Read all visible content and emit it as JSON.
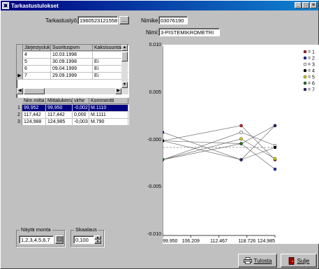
{
  "window": {
    "title": "Tarkastustulokset"
  },
  "form": {
    "tarkastustyo_label": "Tarkastustyö:",
    "tarkastustyo_value": "1960523121558",
    "browse_label": "...",
    "nimike_label": "Nimike:",
    "nimike_value": "03076190",
    "nimi_label": "Nimi:",
    "nimi_value": "3-PISTEMIKROMETRI"
  },
  "top_table": {
    "columns": [
      "Järjestysluku",
      "Suorituspvm",
      "Kaksisuuntai"
    ],
    "rows": [
      {
        "indicator": "",
        "cells": [
          "4",
          "10.03.1998",
          ""
        ]
      },
      {
        "indicator": "",
        "cells": [
          "5",
          "30.09.1998",
          "Ei"
        ]
      },
      {
        "indicator": "",
        "cells": [
          "6",
          "09.04.1999",
          "Ei"
        ]
      },
      {
        "indicator": "▶",
        "cells": [
          "7",
          "29.09.1999",
          "Ei"
        ]
      }
    ]
  },
  "meas_table": {
    "columns": [
      "Nim.mitta",
      "Mittalukema",
      "virhe",
      "Kommentti"
    ],
    "rows": [
      {
        "num": "1",
        "cells": [
          "99,952",
          "99,950",
          "-0,002",
          "M.1110"
        ],
        "selected": true
      },
      {
        "num": "2",
        "cells": [
          "117,442",
          "117,442",
          "0,000",
          "M.1111"
        ],
        "selected": false
      },
      {
        "num": "3",
        "cells": [
          "124,988",
          "124,985",
          "-0,003",
          "M.790"
        ],
        "selected": false
      }
    ]
  },
  "show_group": {
    "title": "Näytä monta",
    "value": "1,2,3,4,5,6,7"
  },
  "scale_group": {
    "title": "Skaalaus",
    "value": "0,100"
  },
  "buttons": {
    "print": "Tulosta",
    "close": "Sulje"
  },
  "chart_data": {
    "type": "line",
    "y_ticks": [
      "0.010",
      "0.005",
      "-0.000",
      "-0.005",
      "-0.010"
    ],
    "x_ticks": [
      "99.950",
      "106.209",
      "112.467",
      "118.726",
      "124.985"
    ],
    "ylim": [
      -0.01,
      0.01
    ],
    "xlim": [
      99.95,
      124.985
    ],
    "legend": [
      {
        "label": "= 1",
        "color": "#cc2020",
        "fill": true
      },
      {
        "label": "= 2",
        "color": "#2030c0",
        "fill": true
      },
      {
        "label": "= 3",
        "color": "#ffffff",
        "fill": true
      },
      {
        "label": "= 4",
        "color": "#000000",
        "fill": true
      },
      {
        "label": "= 5",
        "color": "#e8e800",
        "fill": true
      },
      {
        "label": "= 6",
        "color": "#208020",
        "fill": true
      },
      {
        "label": "= 7",
        "color": "#402080",
        "fill": true
      }
    ],
    "x": [
      99.95,
      117.442,
      124.985
    ],
    "series": [
      {
        "color": "#cc2020",
        "values": [
          0.0,
          0.0016,
          -0.002
        ]
      },
      {
        "color": "#2030c0",
        "values": [
          0.0,
          -0.0003,
          -0.003
        ]
      },
      {
        "color": "#ffffff",
        "values": [
          -0.002,
          0.0009,
          -0.0005
        ]
      },
      {
        "color": "#000000",
        "values": [
          0.0,
          -0.002,
          -0.0007
        ]
      },
      {
        "color": "#e8e800",
        "values": [
          -0.002,
          0.0002,
          -0.0019
        ]
      },
      {
        "color": "#208020",
        "values": [
          -0.002,
          -0.0003,
          0.0016
        ]
      },
      {
        "color": "#402080",
        "values": [
          0.0009,
          -0.002,
          0.0016
        ]
      }
    ],
    "dashed_series": {
      "color": "#888888",
      "values": [
        -0.0007,
        -0.0007,
        -0.0007
      ]
    }
  }
}
